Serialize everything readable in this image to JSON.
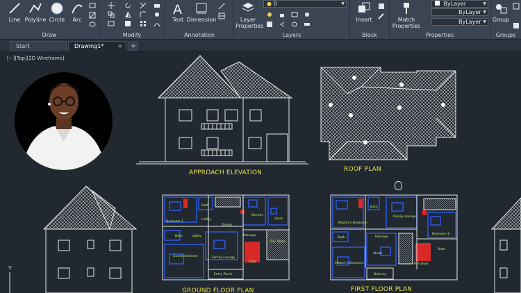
{
  "ribbon": {
    "draw": {
      "label": "Draw",
      "tools": [
        "Line",
        "Polyline",
        "Circle",
        "Arc"
      ]
    },
    "modify": {
      "label": "Modify"
    },
    "annotation": {
      "label": "Annotation",
      "tools": [
        "Text",
        "Dimension"
      ]
    },
    "layers": {
      "label": "Layers",
      "layer_properties": "Layer Properties",
      "current_layer": "0"
    },
    "block": {
      "label": "Block",
      "insert": "Insert"
    },
    "properties": {
      "label": "Properties",
      "match_properties": "Match Properties",
      "color": "ByLayer",
      "linetype": "ByLayer",
      "lineweight": "ByLayer"
    },
    "groups": {
      "label": "Groups",
      "group": "Group"
    }
  },
  "tabs": {
    "start": "Start",
    "drawing": "Drawing1*",
    "close": "×",
    "add": "+"
  },
  "canvas": {
    "viewport_label": "[−][Top][2D Wireframe]",
    "axis_y": "Y",
    "titles": {
      "approach_elevation": "APPROACH ELEVATION",
      "roof_plan": "ROOF PLAN",
      "ground_floor_plan": "GROUND FLOOR PLAN",
      "first_floor_plan": "FIRST FLOOR PLAN"
    },
    "ground_rooms": [
      "Bath",
      "Bedroom 1",
      "Lobby",
      "Dining",
      "Kitchen",
      "Store",
      "Bath",
      "Lobby",
      "Passage",
      "Guest Bedroom",
      "Family Lounge",
      "Stair",
      "Dry Store",
      "Entry Porch"
    ],
    "first_rooms": [
      "Bath",
      "Master's Bedroom",
      "Family Lounge",
      "Bedroom 2",
      "Bath",
      "Passage",
      "Study",
      "Master's Bedroom",
      "Bath",
      "Fire Door",
      "Balcony"
    ]
  },
  "colors": {
    "ribbon_bg": "#3b4453",
    "canvas_bg": "#212830",
    "line": "#e8e8e8",
    "title": "#e9e34a",
    "wall_blue": "#2b57d8",
    "furniture_red": "#d92828",
    "room_label": "#b9f06a"
  }
}
